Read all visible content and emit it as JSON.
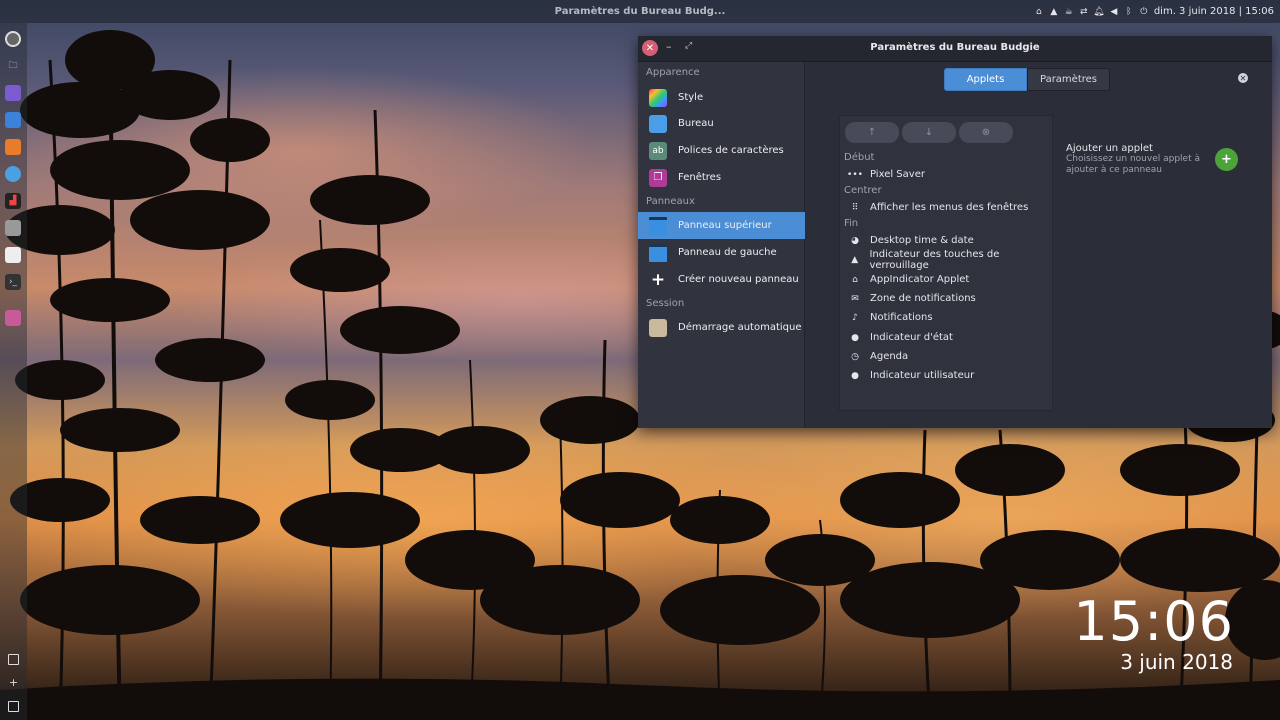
{
  "top_panel": {
    "window_title": "Paramètres du Bureau Budg...",
    "datetime": "dim.  3 juin 2018 | 15:06"
  },
  "desktop_clock": {
    "time": "15:06",
    "date": "3 juin 2018"
  },
  "window": {
    "title": "Paramètres du Bureau Budgie",
    "close_label": "✕",
    "min_label": "–",
    "max_label": "⤢"
  },
  "sidebar": {
    "sections": [
      {
        "label": "Apparence"
      },
      {
        "label": "Panneaux"
      },
      {
        "label": "Session"
      }
    ],
    "items": [
      {
        "label": "Style",
        "icon": "style-icon"
      },
      {
        "label": "Bureau",
        "icon": "desktop-icon"
      },
      {
        "label": "Polices de caractères",
        "icon": "fonts-icon"
      },
      {
        "label": "Fenêtres",
        "icon": "windows-icon"
      },
      {
        "label": "Panneau supérieur",
        "icon": "top-panel-icon",
        "active": true
      },
      {
        "label": "Panneau de gauche",
        "icon": "left-panel-icon"
      },
      {
        "label": "Créer nouveau panneau",
        "icon": "plus-icon"
      },
      {
        "label": "Démarrage automatique",
        "icon": "autostart-icon"
      }
    ]
  },
  "tabs": {
    "applets": "Applets",
    "parametres": "Paramètres"
  },
  "applets": {
    "groups": {
      "debut": "Début",
      "centrer": "Centrer",
      "fin": "Fin"
    },
    "debut_items": [
      {
        "label": "Pixel Saver",
        "icon": "dots-icon"
      }
    ],
    "centrer_items": [
      {
        "label": "Afficher les menus des fenêtres",
        "icon": "grid-icon"
      }
    ],
    "fin_items": [
      {
        "label": "Desktop time & date",
        "icon": "clock-pie-icon"
      },
      {
        "label": "Indicateur des touches de verrouillage",
        "icon": "caps-lock-icon"
      },
      {
        "label": "AppIndicator Applet",
        "icon": "home-icon"
      },
      {
        "label": "Zone de notifications",
        "icon": "mail-icon"
      },
      {
        "label": "Notifications",
        "icon": "bell-icon"
      },
      {
        "label": "Indicateur d'état",
        "icon": "user-status-icon"
      },
      {
        "label": "Agenda",
        "icon": "clock-icon"
      },
      {
        "label": "Indicateur utilisateur",
        "icon": "user-icon"
      }
    ]
  },
  "add_applet": {
    "title": "Ajouter un applet",
    "subtitle": "Choisissez un nouvel applet à ajouter à ce panneau",
    "button": "+"
  },
  "colors": {
    "accent": "#4b8ed6",
    "add_button": "#4ba33a",
    "close_button": "#d45f75"
  }
}
